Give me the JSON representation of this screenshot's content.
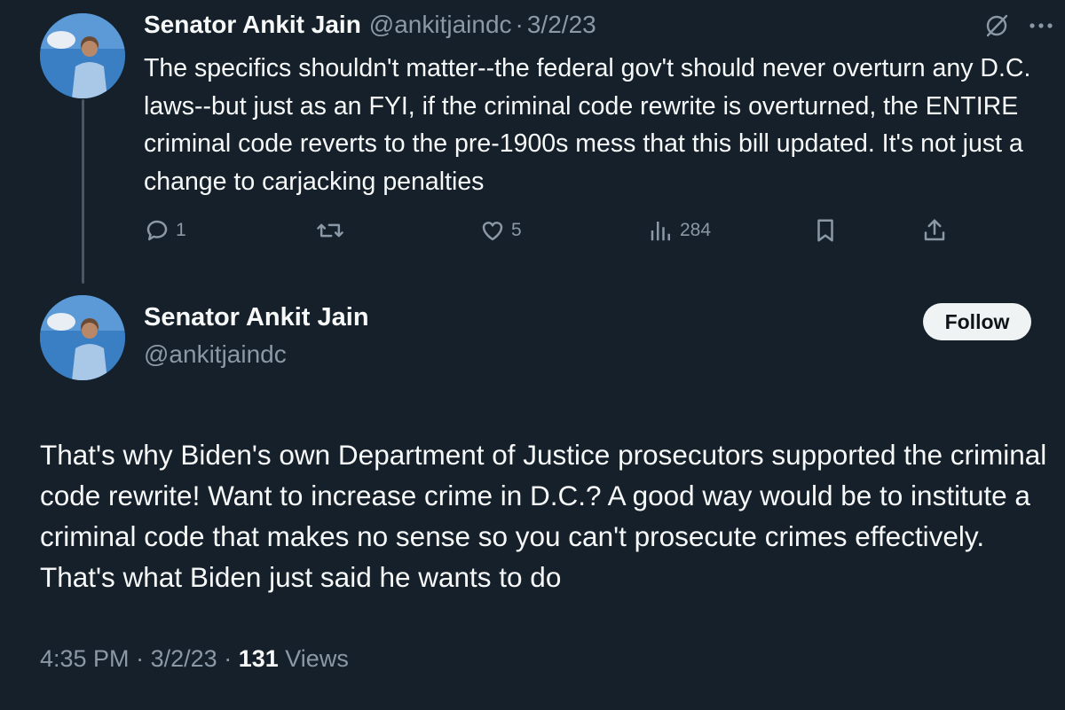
{
  "tweet1": {
    "display_name": "Senator Ankit Jain",
    "handle": "@ankitjaindc",
    "separator": "·",
    "date": "3/2/23",
    "text": "The specifics shouldn't matter--the federal gov't should never overturn any D.C. laws--but just as an FYI, if the criminal code rewrite is overturned, the ENTIRE criminal code reverts to the pre-1900s mess that this bill updated. It's not just a change to carjacking penalties",
    "actions": {
      "replies": "1",
      "retweets": "",
      "likes": "5",
      "views": "284"
    },
    "icons": [
      "grok-icon",
      "more-icon",
      "reply-icon",
      "retweet-icon",
      "like-icon",
      "views-icon",
      "bookmark-icon",
      "share-icon"
    ]
  },
  "tweet2": {
    "display_name": "Senator Ankit Jain",
    "handle": "@ankitjaindc",
    "follow_label": "Follow",
    "text": "That's why Biden's own Department of Justice prosecutors supported the criminal code rewrite! Want to increase crime in D.C.? A good way would be to institute a criminal code that makes no sense so you can't prosecute crimes effectively. That's what Biden just said he wants to do",
    "time": "4:35 PM",
    "separator": "·",
    "date": "3/2/23",
    "views_count": "131",
    "views_label": "Views"
  },
  "colors": {
    "background": "#15202b",
    "text": "#f7f9f9",
    "muted": "#8b98a5",
    "thread_line": "#4a5561",
    "follow_bg": "#eff3f4"
  }
}
